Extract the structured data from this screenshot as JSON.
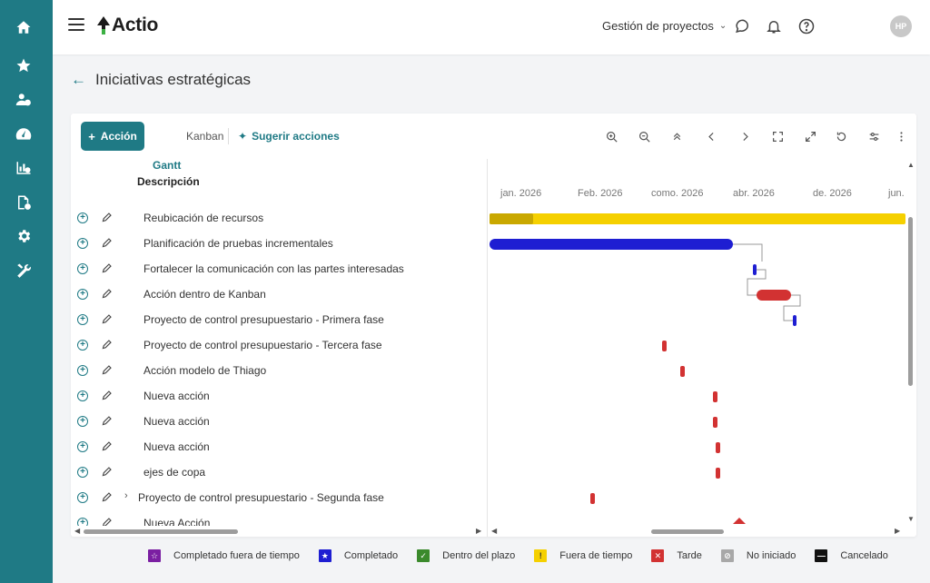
{
  "app": {
    "logo_text": "Actio"
  },
  "header": {
    "module_label": "Gestión de proyectos",
    "avatar_initials": "HP"
  },
  "page": {
    "title": "Iniciativas estratégicas"
  },
  "toolbar": {
    "action_label": "Acción",
    "tab_gantt": "Gantt",
    "tab_kanban": "Kanban",
    "suggest_label": "Sugerir acciones"
  },
  "grid": {
    "description_header": "Descripción",
    "rows": [
      {
        "label": "Reubicación de recursos"
      },
      {
        "label": "Planificación de pruebas incrementales"
      },
      {
        "label": "Fortalecer la comunicación con las partes interesadas"
      },
      {
        "label": "Acción dentro de Kanban"
      },
      {
        "label": "Proyecto de control presupuestario - Primera fase"
      },
      {
        "label": "Proyecto de control presupuestario - Tercera fase"
      },
      {
        "label": "Acción modelo de Thiago"
      },
      {
        "label": "Nueva acción"
      },
      {
        "label": "Nueva acción"
      },
      {
        "label": "Nueva acción"
      },
      {
        "label": "ejes de copa"
      },
      {
        "label": "Proyecto de control presupuestario - Segunda fase"
      },
      {
        "label": "Nueva Acción"
      }
    ]
  },
  "gantt": {
    "months": [
      "jan. 2026",
      "Feb. 2026",
      "como. 2026",
      "abr. 2026",
      "de. 2026",
      "jun."
    ]
  },
  "legend": [
    {
      "label": "Completado fuera de tiempo",
      "color": "#7b1fa2",
      "glyph": "☆"
    },
    {
      "label": "Completado",
      "color": "#1e1ed2",
      "glyph": "★"
    },
    {
      "label": "Dentro del plazo",
      "color": "#3b8a2c",
      "glyph": "✓"
    },
    {
      "label": "Fuera de tiempo",
      "color": "#f5d000",
      "glyph": "!"
    },
    {
      "label": "Tarde",
      "color": "#d23232",
      "glyph": "✕"
    },
    {
      "label": "No iniciado",
      "color": "#a8a8a8",
      "glyph": "⊘"
    },
    {
      "label": "Cancelado",
      "color": "#111111",
      "glyph": "—"
    }
  ],
  "colors": {
    "brand": "#1f7a85",
    "late": "#d23232",
    "on_time_out": "#f5d000",
    "completed": "#1e1ed2"
  }
}
